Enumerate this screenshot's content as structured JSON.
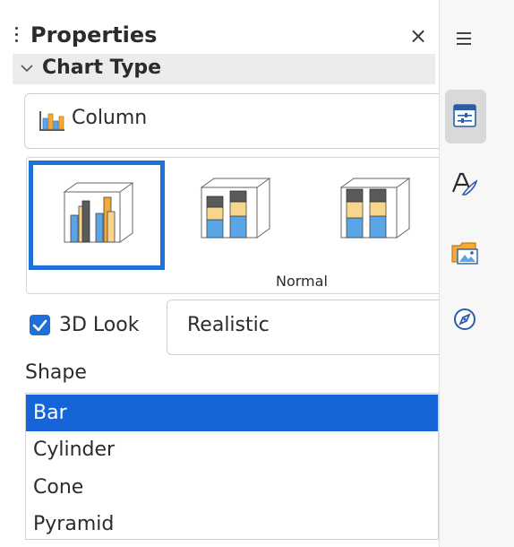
{
  "panel": {
    "title": "Properties",
    "close_label": "×"
  },
  "section": {
    "title": "Chart Type"
  },
  "chart_type": {
    "selected": "Column",
    "icon": "column-chart-icon"
  },
  "variants": {
    "caption": "Normal",
    "items": [
      {
        "name": "column-3d-normal",
        "selected": true
      },
      {
        "name": "column-3d-stacked",
        "selected": false
      },
      {
        "name": "column-3d-percent-stacked",
        "selected": false
      }
    ]
  },
  "look3d": {
    "label": "3D Look",
    "checked": true,
    "scheme": "Realistic"
  },
  "shape": {
    "label": "Shape",
    "options": [
      "Bar",
      "Cylinder",
      "Cone",
      "Pyramid"
    ],
    "selected": "Bar"
  },
  "sidebar_tabs": [
    {
      "icon": "hamburger-menu-icon",
      "active": false
    },
    {
      "icon": "properties-icon",
      "active": true
    },
    {
      "icon": "styles-icon",
      "active": false
    },
    {
      "icon": "gallery-icon",
      "active": false
    },
    {
      "icon": "navigator-icon",
      "active": false
    }
  ],
  "colors": {
    "accent": "#1e6fd6",
    "selection": "#1565d8",
    "bar_orange": "#f4a93b",
    "bar_blue": "#5aa5e6",
    "bar_dark": "#5a5a5a",
    "bar_cream": "#f7d58a"
  }
}
